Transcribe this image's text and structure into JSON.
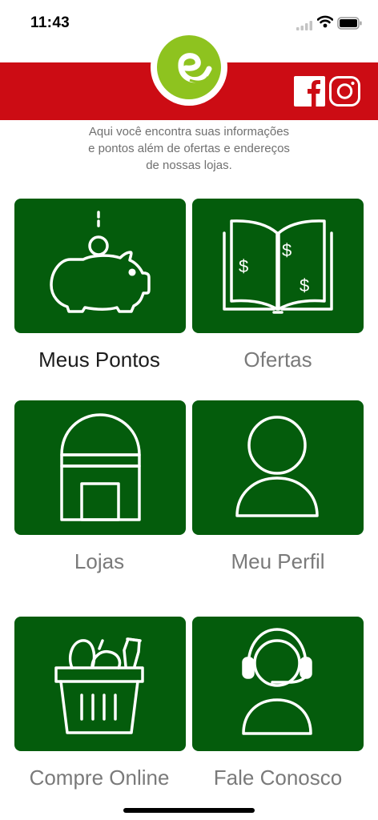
{
  "status_bar": {
    "time": "11:43"
  },
  "header": {
    "brand_color": "#cc0c14",
    "logo_color": "#8ec31f",
    "social": [
      "facebook-icon",
      "instagram-icon"
    ]
  },
  "intro_lines": [
    "Aqui você encontra suas informações",
    "e pontos além de ofertas e endereços",
    "de nossas lojas."
  ],
  "tile_color": "#045c0c",
  "tiles": [
    {
      "label": "Meus Pontos",
      "icon": "piggy-bank-icon",
      "active": true
    },
    {
      "label": "Ofertas",
      "icon": "offers-book-icon",
      "active": false
    },
    {
      "label": "Lojas",
      "icon": "store-icon",
      "active": false
    },
    {
      "label": "Meu Perfil",
      "icon": "profile-icon",
      "active": false
    },
    {
      "label": "Compre Online",
      "icon": "shopping-basket-icon",
      "active": false
    },
    {
      "label": "Fale Conosco",
      "icon": "headset-icon",
      "active": false
    }
  ]
}
